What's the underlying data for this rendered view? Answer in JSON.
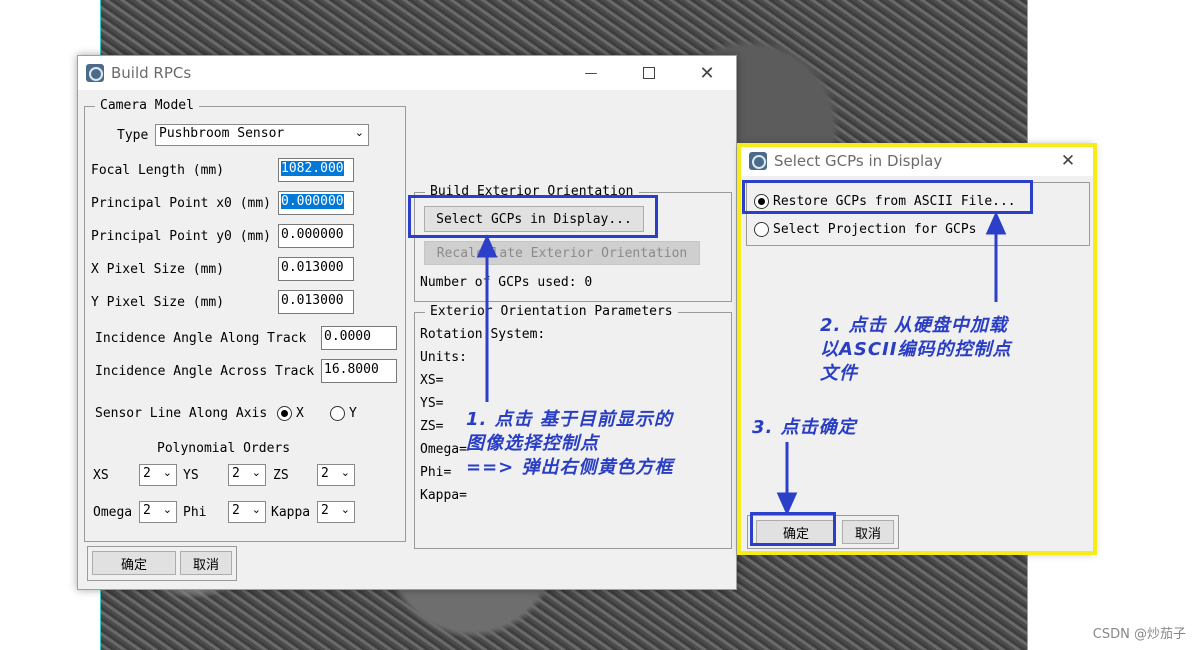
{
  "build_rpcs": {
    "title": "Build RPCs",
    "camera_model": {
      "legend": "Camera Model",
      "type_label": "Type",
      "type_value": "Pushbroom Sensor",
      "focal_length_label": "Focal Length (mm)",
      "focal_length_value": "1082.000",
      "ppx_label": "Principal Point x0 (mm)",
      "ppx_value": "0.000000",
      "ppy_label": "Principal Point y0 (mm)",
      "ppy_value": "0.000000",
      "xpix_label": "X Pixel Size (mm)",
      "xpix_value": "0.013000",
      "ypix_label": "Y Pixel Size (mm)",
      "ypix_value": "0.013000",
      "inc_along_label": "Incidence Angle Along Track",
      "inc_along_value": "0.0000",
      "inc_across_label": "Incidence Angle Across Track",
      "inc_across_value": "16.8000",
      "sensor_axis_label": "Sensor Line Along Axis",
      "axis_x": "X",
      "axis_y": "Y",
      "poly_label": "Polynomial Orders",
      "xs_label": "XS",
      "xs_value": "2",
      "ys_label": "YS",
      "ys_value": "2",
      "zs_label": "ZS",
      "zs_value": "2",
      "omega_label": "Omega",
      "omega_value": "2",
      "phi_label": "Phi",
      "phi_value": "2",
      "kappa_label": "Kappa",
      "kappa_value": "2"
    },
    "build_ext": {
      "legend": "Build Exterior Orientation",
      "select_gcps": "Select GCPs in Display...",
      "recalc": "Recalculate Exterior Orientation",
      "num_gcps": "Number of GCPs used: 0"
    },
    "ext_params": {
      "legend": "Exterior Orientation Parameters",
      "rows": [
        "Rotation System:",
        "Units:",
        "XS=",
        "YS=",
        "ZS=",
        "Omega=",
        "Phi=",
        "Kappa="
      ]
    },
    "ok": "确定",
    "cancel": "取消"
  },
  "select_gcps": {
    "title": "Select GCPs in Display",
    "restore": "Restore GCPs from ASCII File...",
    "select_proj": "Select Projection for GCPs",
    "ok": "确定",
    "cancel": "取消"
  },
  "annotations": {
    "a1_line1": "1. 点击 基于目前显示的",
    "a1_line2": "图像选择控制点",
    "a1_line3": "==> 弹出右侧黄色方框",
    "a2_line1": "2. 点击 从硬盘中加载",
    "a2_line2": "以ASCII编码的控制点",
    "a2_line3": "文件",
    "a3": "3. 点击确定"
  },
  "watermark": "CSDN @炒茄子",
  "colors": {
    "annotation": "#2b3fc8",
    "highlight": "#f5ec19",
    "selection": "#0078d7"
  }
}
